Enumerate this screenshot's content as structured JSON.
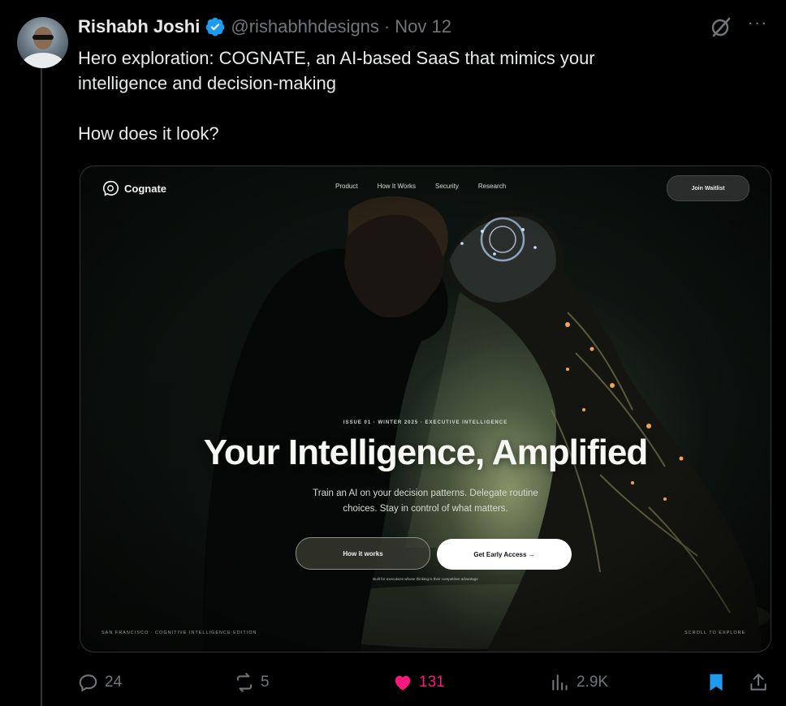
{
  "tweet": {
    "author": {
      "display_name": "Rishabh Joshi",
      "handle": "@rishabhhdesigns",
      "separator": "·",
      "date": "Nov 12",
      "verified": true
    },
    "text_line_1": "Hero exploration: COGNATE, an AI-based SaaS that mimics your",
    "text_line_2": "intelligence and decision-making",
    "text_line_3": "How does it look?",
    "more_label": "···"
  },
  "media": {
    "brand": "Cognate",
    "nav": [
      "Product",
      "How It Works",
      "Security",
      "Research"
    ],
    "waitlist_label": "Join Waitlist",
    "issue_line": "ISSUE 01 · WINTER 2025 · EXECUTIVE INTELLIGENCE",
    "hero_title": "Your Intelligence, Amplified",
    "hero_sub_1": "Train an AI on your decision patterns. Delegate routine",
    "hero_sub_2": "choices. Stay in control of what matters.",
    "secondary_cta": "How it works",
    "primary_cta": "Get Early Access →",
    "tagline": "Built for executives whose thinking is their competitive advantage",
    "footer_left": "SAN FRANCISCO · COGNITIVE INTELLIGENCE EDITION",
    "footer_right": "SCROLL TO EXPLORE"
  },
  "actions": {
    "replies": "24",
    "reposts": "5",
    "likes": "131",
    "views": "2.9K"
  },
  "colors": {
    "background": "#000000",
    "text": "#e7e9ea",
    "muted": "#71767b",
    "verified": "#1d9bf0",
    "like": "#f91880",
    "bookmark": "#1d9bf0"
  },
  "icons": [
    "verified-badge-icon",
    "grok-icon",
    "more-icon",
    "reply-icon",
    "repost-icon",
    "like-icon",
    "views-icon",
    "bookmark-icon",
    "share-icon"
  ]
}
